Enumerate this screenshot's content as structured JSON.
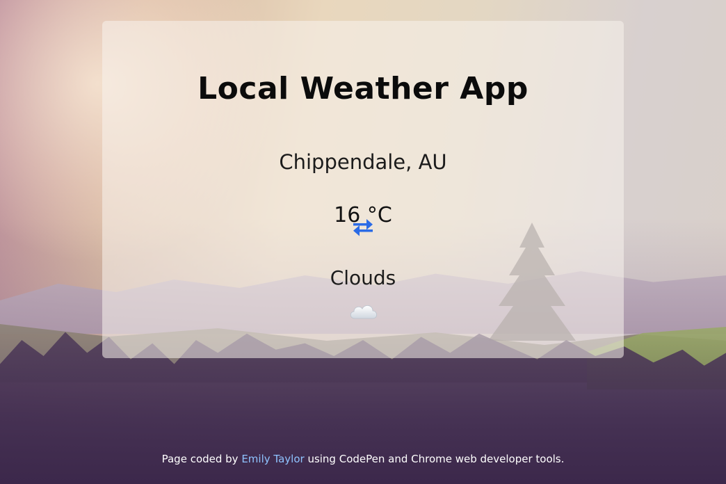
{
  "header": {
    "title": "Local Weather App"
  },
  "weather": {
    "location": "Chippendale, AU",
    "temperature": "16 °C",
    "condition": "Clouds",
    "toggle_icon": "swap-arrows-icon",
    "condition_icon": "cloud-icon"
  },
  "footer": {
    "prefix": "Page coded by ",
    "author": "Emily Taylor",
    "suffix": " using CodePen and Chrome web developer tools."
  },
  "colors": {
    "accent": "#2b6be6",
    "link": "#8fc3ff",
    "text": "#111111"
  }
}
